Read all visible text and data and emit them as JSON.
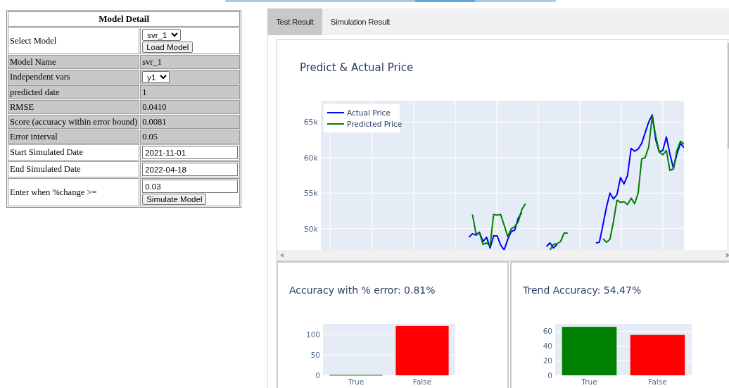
{
  "model_detail": {
    "title": "Model Detail",
    "rows": [
      {
        "kind": "select_button",
        "label": "Select Model",
        "value": "svr_1",
        "button": "Load Model",
        "shaded": false
      },
      {
        "kind": "text",
        "label": "Model Name",
        "value": "svr_1",
        "shaded": true
      },
      {
        "kind": "select",
        "label": "Independent vars",
        "value": "y1",
        "shaded": true
      },
      {
        "kind": "text",
        "label": "predicted date",
        "value": "1",
        "shaded": true
      },
      {
        "kind": "text",
        "label": "RMSE",
        "value": "0.0410",
        "shaded": true
      },
      {
        "kind": "text",
        "label": "Score (accuracy within error bound)",
        "value": "0.0081",
        "shaded": true
      },
      {
        "kind": "text",
        "label": "Error interval",
        "value": "0.05",
        "shaded": true
      },
      {
        "kind": "input",
        "label": "Start Simulated Date",
        "value": "2021-11-01",
        "shaded": false
      },
      {
        "kind": "input",
        "label": "End Simulated Date",
        "value": "2022-04-18",
        "shaded": false
      },
      {
        "kind": "input_button",
        "label": "Enter when %change >=",
        "value": "0.03",
        "button": "Simulate Model",
        "shaded": false
      }
    ]
  },
  "tabs": [
    {
      "label": "Test Result",
      "selected": true
    },
    {
      "label": "Simulation Result",
      "selected": false
    }
  ],
  "price_chart": {
    "chart_data": {
      "type": "line",
      "title": "Predict & Actual Price",
      "ylim": [
        40000,
        68000
      ],
      "grid": true,
      "legend": "upper left",
      "yticks": [
        {
          "value": 50000,
          "label": "50k"
        },
        {
          "value": 55000,
          "label": "55k"
        },
        {
          "value": 60000,
          "label": "60k"
        },
        {
          "value": 65000,
          "label": "65k"
        }
      ],
      "series": [
        {
          "name": "Actual Price",
          "color": "#0000ff",
          "values": [
            null,
            null,
            null,
            null,
            null,
            null,
            null,
            null,
            null,
            null,
            null,
            null,
            null,
            null,
            null,
            null,
            null,
            null,
            null,
            null,
            null,
            null,
            null,
            null,
            null,
            null,
            null,
            null,
            null,
            null,
            null,
            null,
            null,
            null,
            null,
            null,
            null,
            null,
            null,
            null,
            null,
            null,
            48800,
            49300,
            49100,
            49500,
            48200,
            48800,
            47300,
            49000,
            49000,
            47700,
            47000,
            48500,
            49600,
            49800,
            51500,
            52300,
            null,
            null,
            null,
            null,
            null,
            null,
            47500,
            48000,
            47300,
            47800,
            null,
            null,
            null,
            null,
            null,
            null,
            null,
            null,
            null,
            null,
            48000,
            48100,
            50500,
            53000,
            55000,
            54200,
            54800,
            57200,
            56300,
            57500,
            61300,
            60900,
            61200,
            62000,
            63500,
            65000,
            66000,
            62500,
            60800,
            61000,
            62900,
            60500,
            58500,
            60500,
            62000,
            61400
          ]
        },
        {
          "name": "Predicted Price",
          "color": "#008000",
          "values": [
            null,
            null,
            null,
            null,
            null,
            null,
            null,
            null,
            null,
            null,
            null,
            null,
            null,
            null,
            null,
            null,
            null,
            null,
            null,
            null,
            null,
            null,
            null,
            null,
            null,
            null,
            null,
            null,
            null,
            null,
            null,
            null,
            null,
            null,
            null,
            null,
            null,
            null,
            null,
            null,
            null,
            null,
            null,
            52000,
            49300,
            49400,
            47800,
            48000,
            47600,
            52000,
            51900,
            52000,
            50500,
            48900,
            50000,
            50300,
            51000,
            52700,
            53500,
            null,
            null,
            null,
            null,
            null,
            null,
            47000,
            47800,
            47900,
            48200,
            49400,
            49400,
            null,
            null,
            null,
            null,
            null,
            null,
            null,
            null,
            null,
            48600,
            48100,
            48500,
            51000,
            54000,
            53700,
            53800,
            53400,
            54300,
            53500,
            55000,
            59800,
            60000,
            61500,
            65800,
            63000,
            60800,
            60400,
            61000,
            58200,
            58400,
            61000,
            62300,
            61900
          ]
        }
      ]
    }
  },
  "accuracy_charts": [
    {
      "chart_data": {
        "type": "bar",
        "title": "Accuracy with % error: 0.81%",
        "categories": [
          "True",
          "False"
        ],
        "ylim": [
          0,
          126
        ],
        "yticks": [
          0,
          50,
          100
        ],
        "grid": true,
        "series": [
          {
            "color": "#008000",
            "values": [
              1,
              null
            ]
          },
          {
            "color": "#ff0000",
            "values": [
              null,
              121
            ]
          }
        ]
      }
    },
    {
      "chart_data": {
        "type": "bar",
        "title": "Trend Accuracy: 54.47%",
        "categories": [
          "True",
          "False"
        ],
        "ylim": [
          0,
          70
        ],
        "yticks": [
          0,
          20,
          40,
          60
        ],
        "grid": true,
        "series": [
          {
            "color": "#008000",
            "values": [
              66,
              null
            ]
          },
          {
            "color": "#ff0000",
            "values": [
              null,
              55
            ]
          }
        ]
      }
    }
  ]
}
